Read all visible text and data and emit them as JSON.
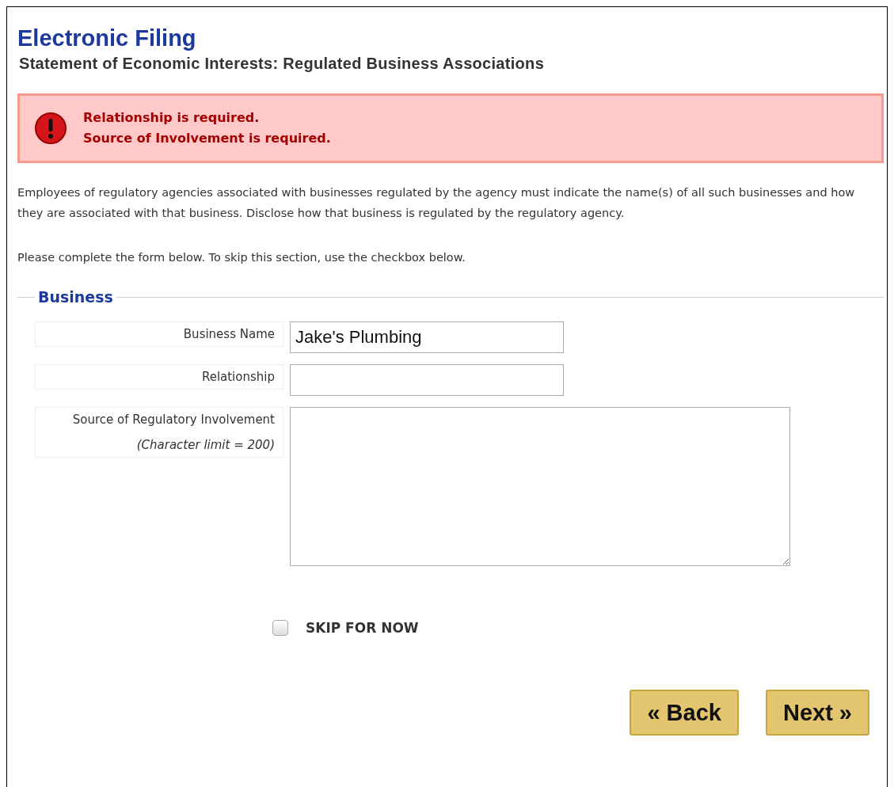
{
  "title": "Electronic Filing",
  "subtitle": "Statement of Economic Interests: Regulated Business Associations",
  "errors": [
    "Relationship is required.",
    "Source of Involvement is required."
  ],
  "paragraphs": [
    "Employees of regulatory agencies associated with businesses regulated by the agency must indicate the name(s) of all such businesses and how they are associated with that business. Disclose how that business is regulated by the regulatory agency.",
    "Please complete the form below. To skip this section, use the checkbox below."
  ],
  "section": {
    "legend": "Business",
    "fields": [
      {
        "kind": "text",
        "label": "Business Name",
        "value": "Jake's Plumbing"
      },
      {
        "kind": "text",
        "label": "Relationship"
      },
      {
        "kind": "textarea",
        "label": "Source of Regulatory Involvement",
        "note": "(Character limit = 200)"
      }
    ]
  },
  "skip": {
    "label": "SKIP FOR NOW",
    "checked": false
  },
  "buttons": [
    "« Back",
    "Next »"
  ]
}
